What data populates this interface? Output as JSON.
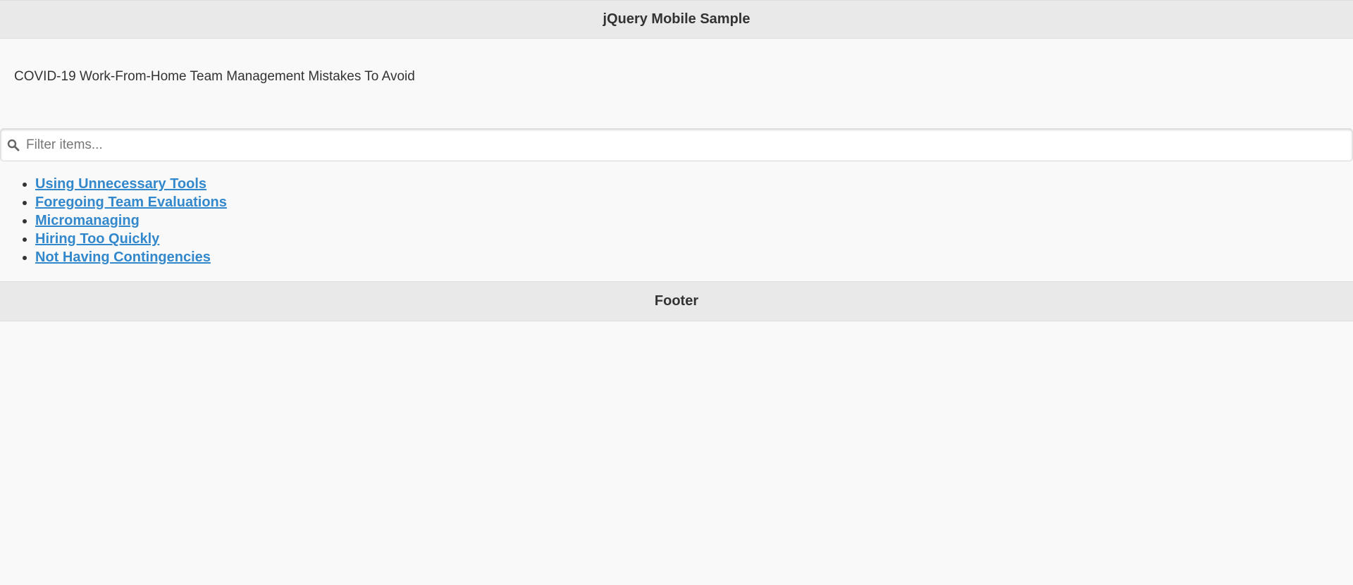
{
  "header": {
    "title": "jQuery Mobile Sample"
  },
  "intro": {
    "text": "COVID-19 Work-From-Home Team Management Mistakes To Avoid"
  },
  "filter": {
    "placeholder": "Filter items...",
    "value": "",
    "icon": "search-icon"
  },
  "items": [
    {
      "label": "Using Unnecessary Tools"
    },
    {
      "label": "Foregoing Team Evaluations"
    },
    {
      "label": "Micromanaging"
    },
    {
      "label": "Hiring Too Quickly"
    },
    {
      "label": "Not Having Contingencies"
    }
  ],
  "footer": {
    "title": "Footer"
  },
  "colors": {
    "bar_background": "#e9e9e9",
    "page_background": "#f9f9f9",
    "link": "#3388cc",
    "text": "#333333"
  }
}
